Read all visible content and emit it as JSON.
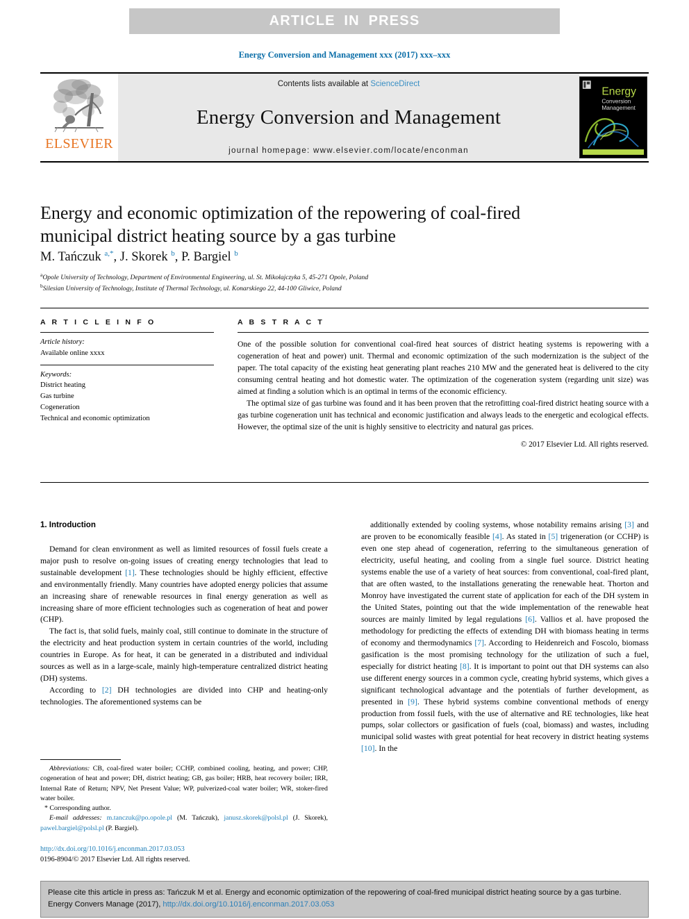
{
  "banner": {
    "text": "ARTICLE IN PRESS"
  },
  "running_head": "Energy Conversion and Management xxx (2017) xxx–xxx",
  "masthead": {
    "contents_prefix": "Contents lists available at ",
    "sciencedirect": "ScienceDirect",
    "journal_name": "Energy Conversion and Management",
    "homepage": "journal homepage: www.elsevier.com/locate/enconman",
    "publisher_logo_text": "ELSEVIER",
    "cover_title_line1": "Energy",
    "cover_title_line2": "Conversion",
    "cover_title_line3": "Management"
  },
  "article": {
    "title": "Energy and economic optimization of the repowering of coal-fired municipal district heating source by a gas turbine",
    "authors_html": "M. Tańczuk <sup>a,*</sup>, J. Skorek <sup>b</sup>, P. Bargiel <sup>b</sup>",
    "affiliation_a": "Opole University of Technology, Department of Environmental Engineering, ul. St. Mikołajczyka 5, 45-271 Opole, Poland",
    "affiliation_b": "Silesian University of Technology, Institute of Thermal Technology, ul. Konarskiego 22, 44-100 Gliwice, Poland",
    "affiliation_a_marker": "a",
    "affiliation_b_marker": "b"
  },
  "info": {
    "heading": "A R T I C L E   I N F O",
    "history_label": "Article history:",
    "history_value": "Available online xxxx",
    "keywords_label": "Keywords:",
    "keywords": [
      "District heating",
      "Gas turbine",
      "Cogeneration",
      "Technical and economic optimization"
    ]
  },
  "abstract": {
    "heading": "A B S T R A C T",
    "paragraph_1": "One of the possible solution for conventional coal-fired heat sources of district heating systems is repowering with a cogeneration of heat and power) unit. Thermal and economic optimization of the such modernization is the subject of the paper. The total capacity of the existing heat generating plant reaches 210 MW and the generated heat is delivered to the city consuming central heating and hot domestic water. The optimization of the cogeneration system (regarding unit size) was aimed at finding a solution which is an optimal in terms of the economic efficiency.",
    "paragraph_2": "The optimal size of gas turbine was found and it has been proven that the retrofitting coal-fired district heating source with a gas turbine cogeneration unit has technical and economic justification and always leads to the energetic and ecological effects. However, the optimal size of the unit is highly sensitive to electricity and natural gas prices.",
    "copyright": "© 2017 Elsevier Ltd. All rights reserved."
  },
  "body": {
    "section_title": "1. Introduction",
    "left_paragraphs_html": [
      "Demand for clean environment as well as limited resources of fossil fuels create a major push to resolve on-going issues of creating energy technologies that lead to sustainable development <span class=\"ref\">[1]</span>. These technologies should be highly efficient, effective and environmentally friendly. Many countries have adopted energy policies that assume an increasing share of renewable resources in final energy generation as well as increasing share of more efficient technologies such as cogeneration of heat and power (CHP).",
      "The fact is, that solid fuels, mainly coal, still continue to dominate in the structure of the electricity and heat production system in certain countries of the world, including countries in Europe. As for heat, it can be generated in a distributed and individual sources as well as in a large-scale, mainly high-temperature centralized district heating (DH) systems.",
      "According to <span class=\"ref\">[2]</span> DH technologies are divided into CHP and heating-only technologies. The aforementioned systems can be"
    ],
    "right_paragraphs_html": [
      "additionally extended by cooling systems, whose notability remains arising <span class=\"ref\">[3]</span> and are proven to be economically feasible <span class=\"ref\">[4]</span>. As stated in <span class=\"ref\">[5]</span> trigeneration (or CCHP) is even one step ahead of cogeneration, referring to the simultaneous generation of electricity, useful heating, and cooling from a single fuel source. District heating systems enable the use of a variety of heat sources: from conventional, coal-fired plant, that are often wasted, to the installations generating the renewable heat. Thorton and Monroy have investigated the current state of application for each of the DH system in the United States, pointing out that the wide implementation of the renewable heat sources are mainly limited by legal regulations <span class=\"ref\">[6]</span>. Vallios et al. have proposed the methodology for predicting the effects of extending DH with biomass heating in terms of economy and thermodynamics <span class=\"ref\">[7]</span>. According to Heidenreich and Foscolo, biomass gasification is the most promising technology for the utilization of such a fuel, especially for district heating <span class=\"ref\">[8]</span>. It is important to point out that DH systems can also use different energy sources in a common cycle, creating hybrid systems, which gives a significant technological advantage and the potentials of further development, as presented in <span class=\"ref\">[9]</span>. These hybrid systems combine conventional methods of energy production from fossil fuels, with the use of alternative and RE technologies, like heat pumps, solar collectors or gasification of fuels (coal, biomass) and wastes, including municipal solid wastes with great potential for heat recovery in district heating systems <span class=\"ref\">[10]</span>. In the"
    ]
  },
  "footnotes": {
    "abbreviations_html": "<span class=\"it\">Abbreviations:</span> CB, coal-fired water boiler; CCHP, combined cooling, heating, and power; CHP, cogeneration of heat and power; DH, district heating; GB, gas boiler; HRB, heat recovery boiler; IRR, Internal Rate of Return; NPV, Net Present Value; WP, pulverized-coal water boiler; WR, stoker-fired water boiler.",
    "corresponding": "* Corresponding author.",
    "emails_html": "<span class=\"it\">E-mail addresses:</span> <span class=\"link\">m.tanczuk@po.opole.pl</span> (M. Tańczuk), <span class=\"link\">janusz.skorek@polsl.pl</span> (J. Skorek), <span class=\"link\">pawel.bargiel@polsl.pl</span> (P. Bargiel)."
  },
  "doi_block": {
    "doi_url": "http://dx.doi.org/10.1016/j.enconman.2017.03.053",
    "issn_line": "0196-8904/© 2017 Elsevier Ltd. All rights reserved."
  },
  "cite_footer": {
    "text_before": "Please cite this article in press as: Tańczuk M et al. Energy and economic optimization of the repowering of coal-fired municipal district heating source by a gas turbine. Energy Convers Manage (2017), ",
    "link": "http://dx.doi.org/10.1016/j.enconman.2017.03.053"
  },
  "colors": {
    "banner_bg": "#c6c6c6",
    "masthead_bg": "#e8e8e8",
    "link_blue": "#1f7fb8",
    "elsevier_orange": "#e87422",
    "running_head_blue": "#0b6ea8"
  }
}
